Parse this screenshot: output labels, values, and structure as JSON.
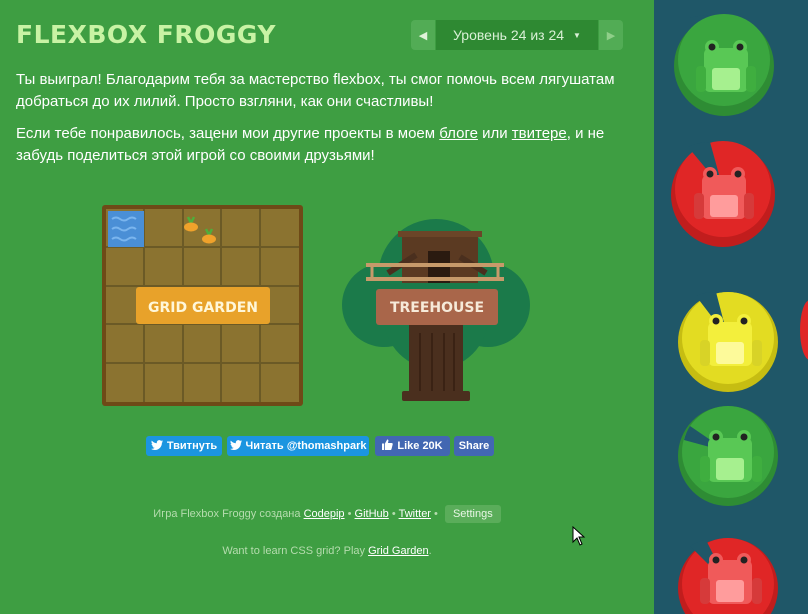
{
  "header": {
    "title": "FLEXBOX FROGGY",
    "level_label": "Уровень 24 из 24"
  },
  "intro": {
    "win_text": "Ты выиграл! Благодарим тебя за мастерство flexbox, ты смог помочь всем лягушатам добраться до их лилий. Просто взгляни, как они счастливы!",
    "projects_prefix": "Если тебе понравилось, зацени мои другие проекты в моем ",
    "blog_link": "блоге",
    "or_text": " или ",
    "twitter_link": "твитере",
    "projects_suffix": ", и не забудь поделиться этой игрой со своими друзьями!"
  },
  "projects": {
    "grid_garden_label": "GRID GARDEN",
    "treehouse_label": "TREEHOUSE"
  },
  "share": {
    "tweet_label": "Твитнуть",
    "follow_label": "Читать @thomashpark",
    "like_label": "Like 20K",
    "fb_share_label": "Share"
  },
  "footer": {
    "credit_prefix": "Игра Flexbox Froggy создана",
    "codepip_link": "Codepip",
    "github_link": "GitHub",
    "twitter_link": "Twitter",
    "bullet": "•",
    "settings_label": "Settings",
    "grid_prefix": "Want to learn CSS grid? Play",
    "grid_link": "Grid Garden",
    "grid_suffix": "."
  },
  "colors": {
    "background_green": "#3e9e42",
    "pond_blue": "#1f5768",
    "title_green": "#c8f3a4",
    "frog_green": "#59c855",
    "frog_red": "#e84b4b",
    "frog_yellow": "#e8e026",
    "twitter_blue": "#1b95e0",
    "facebook_blue": "#4267b2"
  },
  "board": {
    "lilypads": [
      {
        "color": "green",
        "icon": "frog-on-lilypad"
      },
      {
        "color": "red",
        "icon": "frog-on-lilypad"
      },
      {
        "color": "yellow",
        "icon": "frog-on-lilypad"
      },
      {
        "color": "green",
        "icon": "frog-on-lilypad"
      },
      {
        "color": "red",
        "icon": "frog-on-lilypad"
      }
    ]
  }
}
